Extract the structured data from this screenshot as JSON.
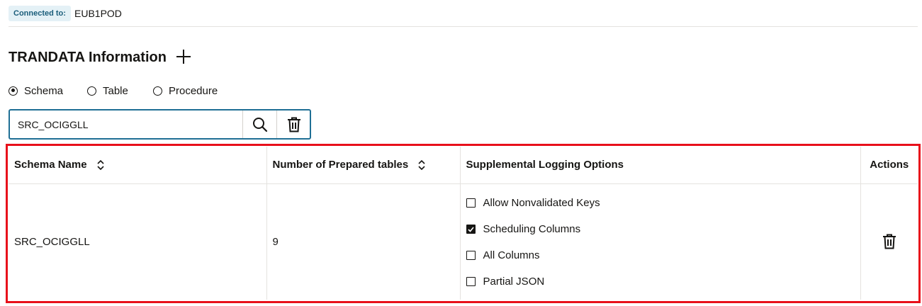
{
  "connection": {
    "label": "Connected to:",
    "value": "EUB1POD"
  },
  "section": {
    "title": "TRANDATA Information",
    "add_icon": "plus-icon"
  },
  "filter_type": {
    "options": [
      "Schema",
      "Table",
      "Procedure"
    ],
    "selected": "Schema"
  },
  "search": {
    "value": "SRC_OCIGGLL",
    "search_icon": "magnifier-icon",
    "clear_icon": "trash-icon"
  },
  "table": {
    "columns": [
      "Schema Name",
      "Number of Prepared tables",
      "Supplemental Logging Options",
      "Actions"
    ],
    "rows": [
      {
        "schema_name": "SRC_OCIGGLL",
        "prepared_tables": "9",
        "options": [
          {
            "label": "Allow Nonvalidated Keys",
            "checked": false
          },
          {
            "label": "Scheduling Columns",
            "checked": true
          },
          {
            "label": "All Columns",
            "checked": false
          },
          {
            "label": "Partial JSON",
            "checked": false
          }
        ],
        "action_icon": "trash-icon"
      }
    ]
  },
  "colors": {
    "accent": "#1f6f95",
    "highlight": "#e8101b",
    "badge_bg": "#e4f1f6"
  }
}
